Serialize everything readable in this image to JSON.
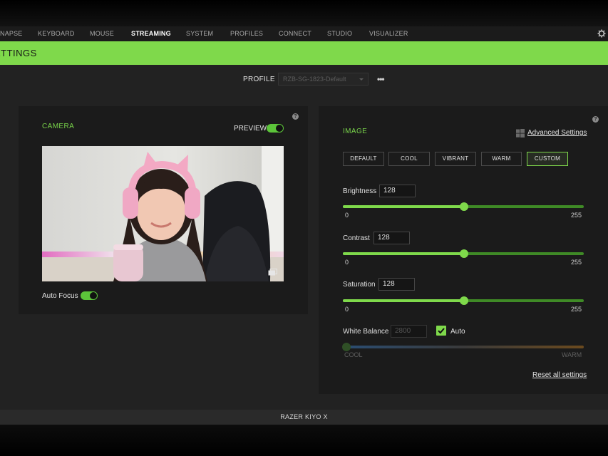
{
  "nav": {
    "items": [
      {
        "label": "NAPSE",
        "active": false
      },
      {
        "label": "KEYBOARD",
        "active": false
      },
      {
        "label": "MOUSE",
        "active": false
      },
      {
        "label": "STREAMING",
        "active": true
      },
      {
        "label": "SYSTEM",
        "active": false
      },
      {
        "label": "PROFILES",
        "active": false
      },
      {
        "label": "CONNECT",
        "active": false
      },
      {
        "label": "STUDIO",
        "active": false
      },
      {
        "label": "VISUALIZER",
        "active": false
      }
    ],
    "settings_icon": "gear-icon"
  },
  "banner": {
    "title": "ETTINGS"
  },
  "profile": {
    "label": "PROFILE",
    "selected": "RZB-SG-1823-Default",
    "more_icon": "more-dots-icon"
  },
  "camera": {
    "title": "CAMERA",
    "preview_label": "PREVIEW",
    "preview_on": true,
    "auto_focus_label": "Auto Focus",
    "auto_focus_on": true,
    "help_icon": "help-icon",
    "fullscreen_icon": "fullscreen-icon"
  },
  "image": {
    "title": "IMAGE",
    "advanced_settings": "Advanced Settings",
    "presets": [
      {
        "label": "DEFAULT",
        "active": false
      },
      {
        "label": "COOL",
        "active": false
      },
      {
        "label": "VIBRANT",
        "active": false
      },
      {
        "label": "WARM",
        "active": false
      },
      {
        "label": "CUSTOM",
        "active": true
      }
    ],
    "brightness": {
      "label": "Brightness",
      "value": "128",
      "min": "0",
      "max": "255"
    },
    "contrast": {
      "label": "Contrast",
      "value": "128",
      "min": "0",
      "max": "255"
    },
    "saturation": {
      "label": "Saturation",
      "value": "128",
      "min": "0",
      "max": "255"
    },
    "white_balance": {
      "label": "White Balance",
      "value": "2800",
      "auto_label": "Auto",
      "auto_checked": true,
      "min_label": "COOL",
      "max_label": "WARM"
    },
    "reset_label": "Reset all settings"
  },
  "footer": {
    "device": "RAZER KIYO X"
  },
  "colors": {
    "accent": "#7fd94b",
    "panel": "#1b1b1b",
    "background": "#222222"
  }
}
